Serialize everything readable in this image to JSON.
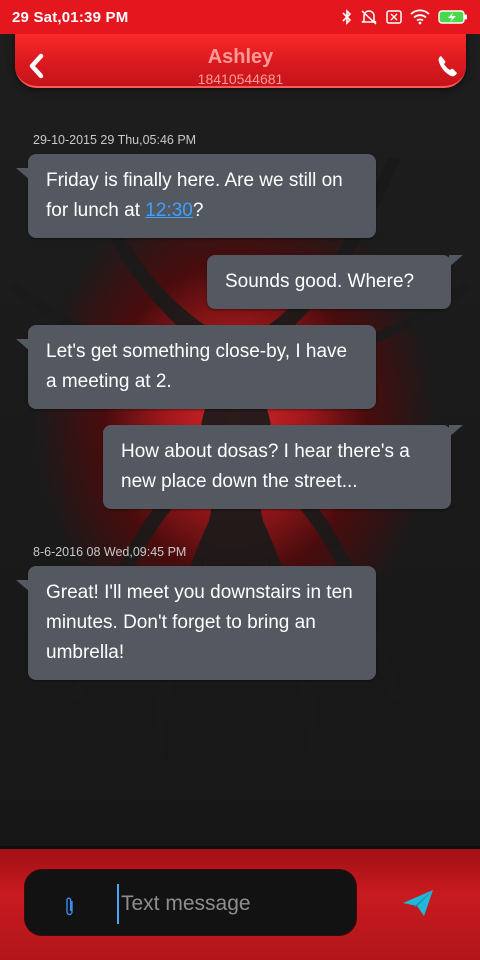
{
  "status_bar": {
    "time": "29 Sat,01:39 PM",
    "icons": [
      "bluetooth-icon",
      "mute-icon",
      "sim-icon",
      "wifi-icon",
      "battery-charging-icon"
    ]
  },
  "header": {
    "contact_name": "Ashley",
    "contact_number": "18410544681",
    "back_icon": "chevron-left-icon",
    "call_icon": "phone-icon"
  },
  "messages": [
    {
      "type": "date",
      "text": "29-10-2015 29 Thu,05:46 PM"
    },
    {
      "type": "incoming",
      "text_before": "Friday is finally here. Are we still on for lunch at ",
      "link": "12:30",
      "text_after": "?"
    },
    {
      "type": "outgoing",
      "text": "Sounds good. Where?"
    },
    {
      "type": "incoming",
      "text": "Let's get something close-by, I have a meeting at 2."
    },
    {
      "type": "outgoing",
      "text": "How about dosas? I hear there's a new place down the street..."
    },
    {
      "type": "date",
      "text": "8-6-2016 08 Wed,09:45 PM"
    },
    {
      "type": "incoming",
      "text": "Great! I'll meet you downstairs in ten minutes. Don't forget to bring an umbrella!"
    }
  ],
  "composer": {
    "placeholder": "Text message",
    "value": "",
    "attach_icon": "paperclip-icon",
    "send_icon": "send-icon"
  },
  "colors": {
    "accent_red": "#e4161e",
    "bubble": "#535861",
    "link": "#3ea0ff",
    "send": "#1fb8d8"
  }
}
